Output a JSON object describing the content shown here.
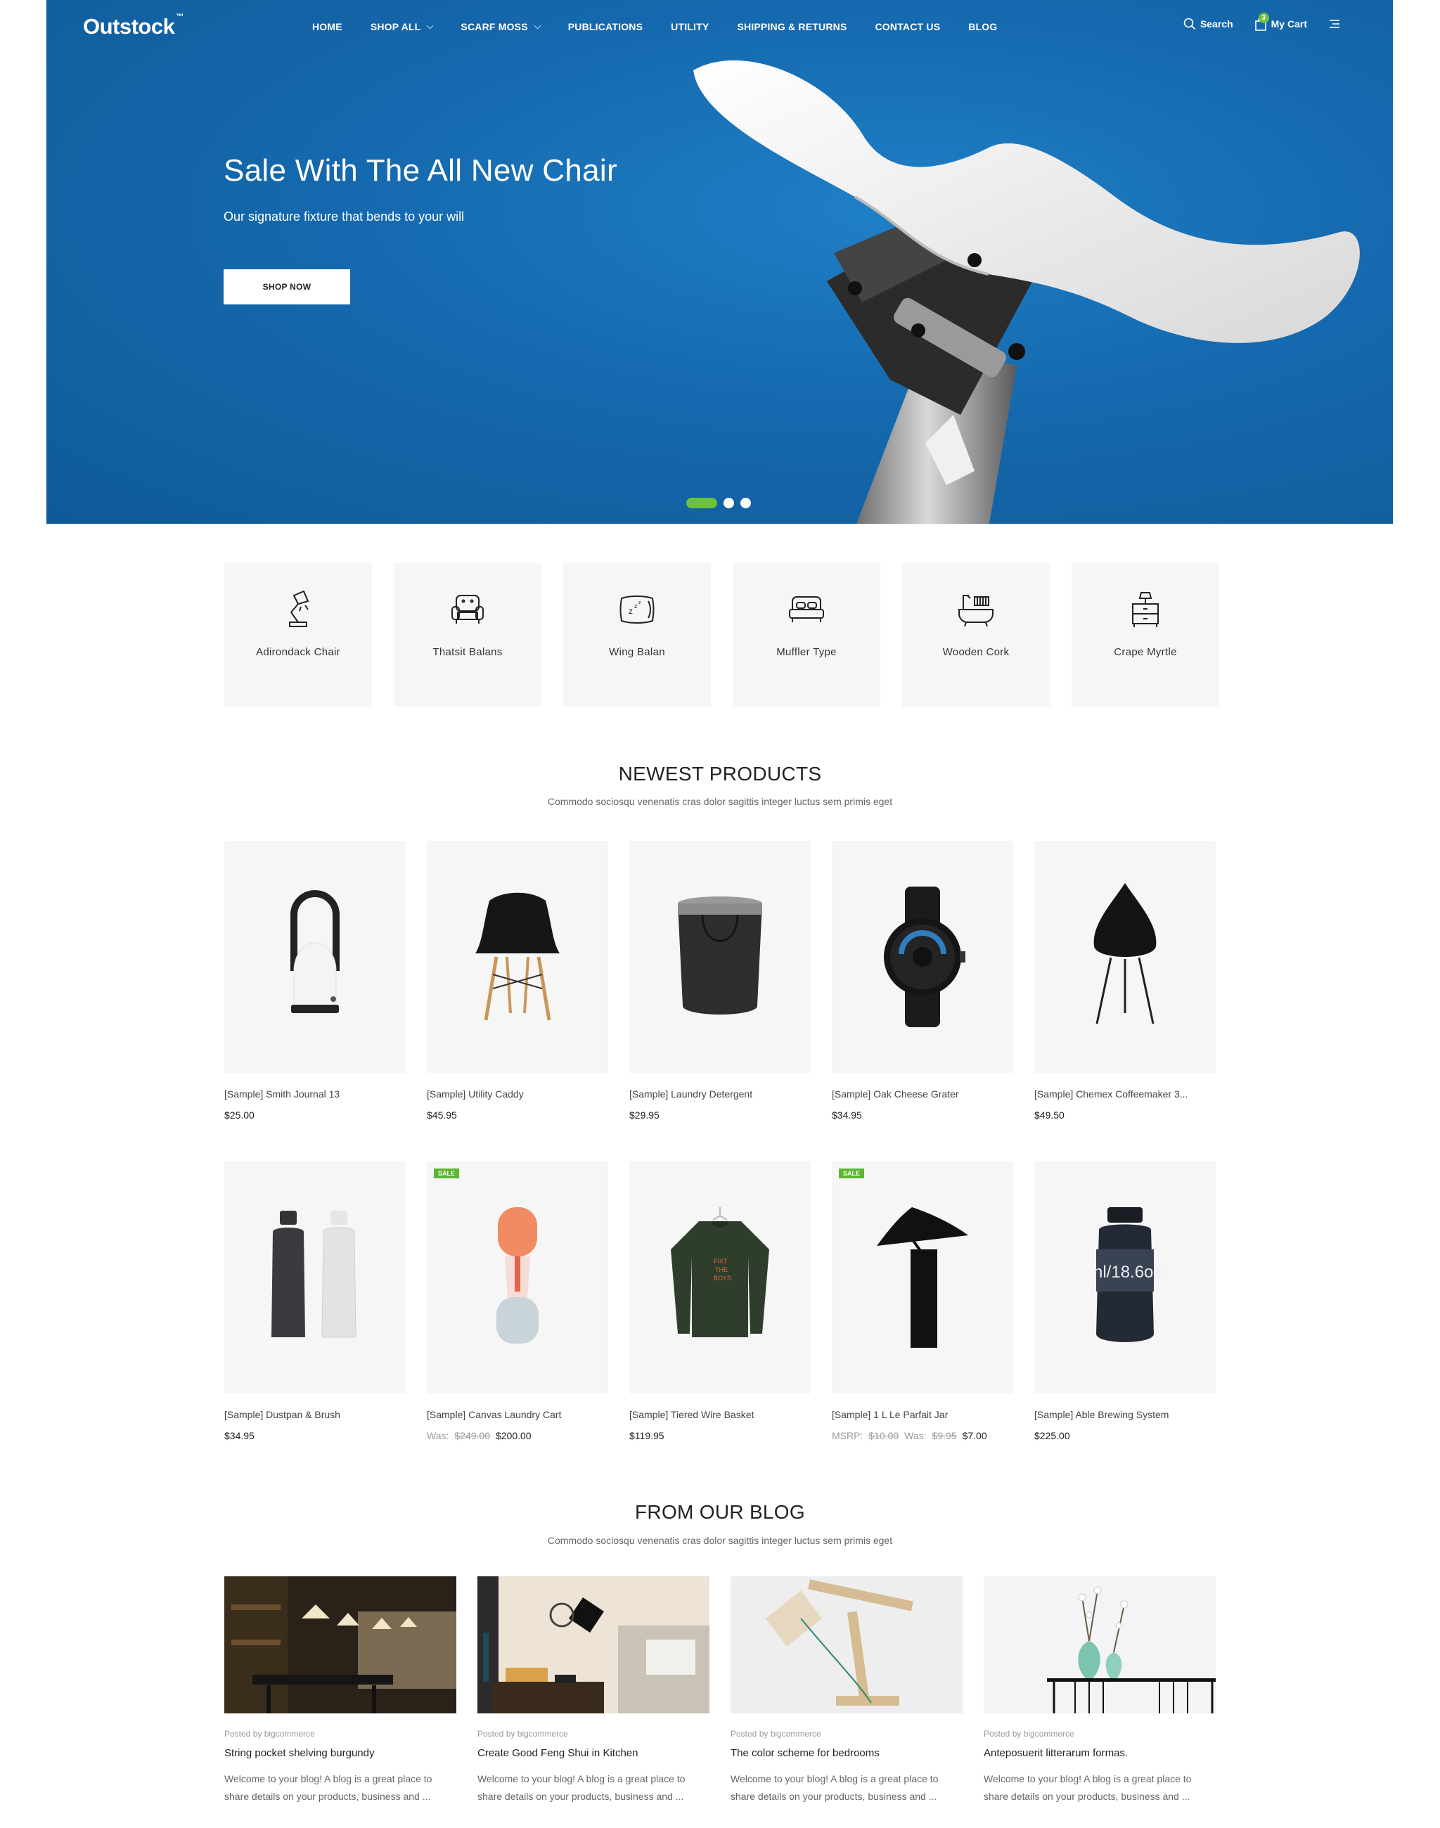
{
  "header": {
    "logo": "Outstock",
    "logo_tm": "™",
    "nav": [
      {
        "label": "HOME",
        "dropdown": false
      },
      {
        "label": "SHOP ALL",
        "dropdown": true
      },
      {
        "label": "SCARF MOSS",
        "dropdown": true
      },
      {
        "label": "PUBLICATIONS",
        "dropdown": false
      },
      {
        "label": "UTILITY",
        "dropdown": false
      },
      {
        "label": "SHIPPING & RETURNS",
        "dropdown": false
      },
      {
        "label": "CONTACT US",
        "dropdown": false
      },
      {
        "label": "BLOG",
        "dropdown": false
      }
    ],
    "search_label": "Search",
    "cart_label": "My Cart",
    "cart_count": "3"
  },
  "hero": {
    "title": "Sale With The All New Chair",
    "subtitle": "Our signature fixture that bends to your will",
    "button": "SHOP NOW",
    "slide_count": 3,
    "active_slide": 0,
    "colors": {
      "background": "#1569ae",
      "accent": "#6ec23a"
    }
  },
  "categories": [
    {
      "label": "Adirondack Chair",
      "icon": "desk-lamp-icon"
    },
    {
      "label": "Thatsit Balans",
      "icon": "armchair-icon"
    },
    {
      "label": "Wing Balan",
      "icon": "pillow-icon"
    },
    {
      "label": "Muffler Type",
      "icon": "bed-icon"
    },
    {
      "label": "Wooden Cork",
      "icon": "bathtub-icon"
    },
    {
      "label": "Crape Myrtle",
      "icon": "nightstand-icon"
    }
  ],
  "newest": {
    "title": "NEWEST PRODUCTS",
    "subtitle": "Commodo sociosqu venenatis cras dolor sagittis integer luctus sem primis eget"
  },
  "products": [
    {
      "name": "[Sample] Smith Journal 13",
      "price": "$25.00",
      "image": "lantern"
    },
    {
      "name": "[Sample] Utility Caddy",
      "price": "$45.95",
      "image": "chair"
    },
    {
      "name": "[Sample] Laundry Detergent",
      "price": "$29.95",
      "image": "basket"
    },
    {
      "name": "[Sample] Oak Cheese Grater",
      "price": "$34.95",
      "image": "watch"
    },
    {
      "name": "[Sample] Chemex Coffeemaker 3...",
      "price": "$49.50",
      "image": "stool"
    },
    {
      "name": "[Sample] Dustpan & Brush",
      "price": "$34.95",
      "image": "grinders"
    },
    {
      "name": "[Sample] Canvas Laundry Cart",
      "sale": "SALE",
      "was_label": "Was:",
      "was": "$249.00",
      "price": "$200.00",
      "image": "bottle"
    },
    {
      "name": "[Sample] Tiered Wire Basket",
      "price": "$119.95",
      "image": "sweater"
    },
    {
      "name": "[Sample] 1 L Le Parfait Jar",
      "sale": "SALE",
      "msrp_label": "MSRP:",
      "msrp": "$10.00",
      "was_label": "Was:",
      "was": "$9.95",
      "price": "$7.00",
      "image": "lamp"
    },
    {
      "name": "[Sample] Able Brewing System",
      "price": "$225.00",
      "image": "jar",
      "jar_label": "nl/18.6oz"
    }
  ],
  "blog": {
    "title": "FROM OUR BLOG",
    "subtitle": "Commodo sociosqu venenatis cras dolor sagittis integer luctus sem primis eget",
    "posts": [
      {
        "meta": "Posted by bigcommerce",
        "title": "String pocket shelving burgundy",
        "text": "Welcome to your blog! A blog is a great place to share details on your products, business and ..."
      },
      {
        "meta": "Posted by bigcommerce",
        "title": "Create Good Feng Shui in Kitchen",
        "text": "Welcome to your blog! A blog is a great place to share details on your products, business and ..."
      },
      {
        "meta": "Posted by bigcommerce",
        "title": "The color scheme for bedrooms",
        "text": "Welcome to your blog! A blog is a great place to share details on your products, business and ..."
      },
      {
        "meta": "Posted by bigcommerce",
        "title": "Anteposuerit litterarum formas.",
        "text": "Welcome to your blog! A blog is a great place to share details on your products, business and ..."
      }
    ]
  }
}
